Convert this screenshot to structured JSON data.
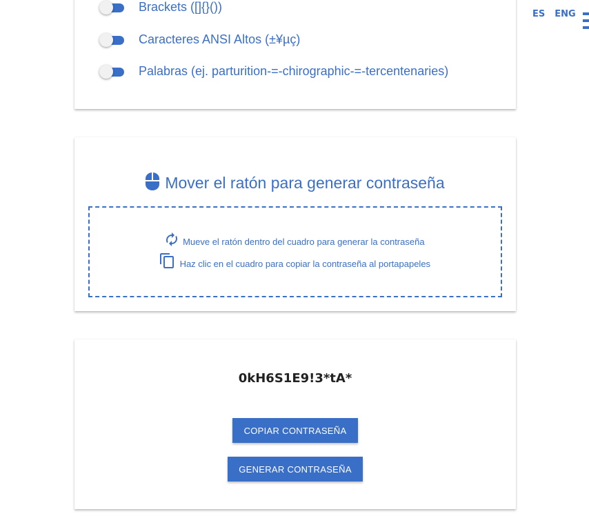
{
  "language": {
    "options": [
      "ES",
      "ENG"
    ]
  },
  "menu": {
    "icon": "hamburger-menu-icon"
  },
  "options": [
    {
      "label": "Brackets ([]{}())",
      "enabled": true
    },
    {
      "label": "Caracteres ANSI Altos (±¥µç)",
      "enabled": true
    },
    {
      "label": "Palabras (ej. parturition-=-chirographic-=-tercentenaries)",
      "enabled": true
    }
  ],
  "mouse_section": {
    "icon": "mouse-icon",
    "title": "Mover el ratón para generar contraseña",
    "hint_move": "Mueve el ratón dentro del cuadro para generar la contraseña",
    "hint_move_icon": "refresh-icon",
    "hint_copy": "Haz clic en el cuadro para copiar la contraseña al portapapeles",
    "hint_copy_icon": "copy-icon"
  },
  "result": {
    "password": "0kH6S1E9!3*tA*",
    "copy_button": "COPIAR CONTRASEÑA",
    "generate_button": "GENERAR CONTRASEÑA"
  },
  "colors": {
    "accent": "#3a6fc8",
    "password_text": "#222222"
  }
}
